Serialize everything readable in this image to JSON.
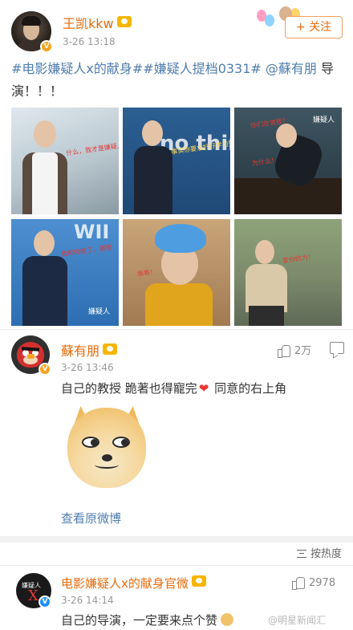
{
  "post": {
    "username": "王凯kkw",
    "timestamp": "3-26 13:18",
    "follow_label": "+ 关注",
    "text_tags": "#电影嫌疑人x的献身##嫌疑人提档0331#",
    "text_mention": " @蘇有朋",
    "text_body": " 导演！！！"
  },
  "photos": [
    {
      "caption": "什么，我才是嫌疑人吗"
    },
    {
      "caption": "事实你要求好好学习知识",
      "overlay": "no thin\nins."
    },
    {
      "caption": "你们在说我？",
      "caption2": "为什么！",
      "watermark": "嫌疑人"
    },
    {
      "caption": "我和你做了，要是",
      "overlay": "WII",
      "watermark": "嫌疑人"
    },
    {
      "caption": "乖乖！"
    },
    {
      "caption": "爱你的力！"
    }
  ],
  "comment1": {
    "username": "蘇有朋",
    "timestamp": "3-26 13:46",
    "like_count": "2万",
    "text_before_heart": "自己的教授 跪著也得寵完",
    "heart": "❤",
    "text_after_heart": " 同意的右上角",
    "sticker": "doge",
    "view_original": "查看原微博"
  },
  "sort": {
    "label": "按热度"
  },
  "comment2": {
    "username": "电影嫌疑人x的献身官微",
    "avatar_text": "嫌疑人",
    "avatar_x": "X",
    "timestamp": "3-26 14:14",
    "like_count": "2978",
    "text": "自己的导演，一定要来点个赞"
  },
  "watermark": "@明星新闻汇"
}
